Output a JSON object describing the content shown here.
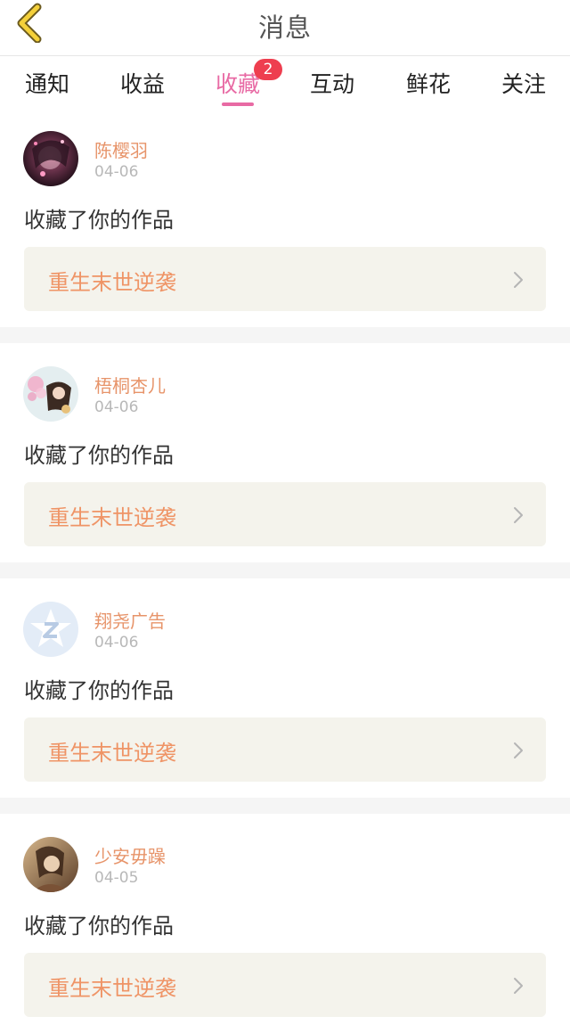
{
  "header": {
    "title": "消息",
    "back_icon": "chevron-left-icon"
  },
  "tabs": [
    {
      "label": "通知",
      "active": false
    },
    {
      "label": "收益",
      "active": false
    },
    {
      "label": "收藏",
      "active": true,
      "badge": "2"
    },
    {
      "label": "互动",
      "active": false
    },
    {
      "label": "鲜花",
      "active": false
    },
    {
      "label": "关注",
      "active": false
    }
  ],
  "colors": {
    "accent": "#e86aa4",
    "badge": "#ee3e4f",
    "username": "#e7946a",
    "work_title": "#ef9466",
    "work_bg": "#f4f3ec"
  },
  "notifications": [
    {
      "user": "陈樱羽",
      "date": "04-06",
      "action": "收藏了你的作品",
      "work": "重生末世逆袭",
      "avatar": "anime-girl-dark-avatar"
    },
    {
      "user": "梧桐杏儿",
      "date": "04-06",
      "action": "收藏了你的作品",
      "work": "重生末世逆袭",
      "avatar": "anime-girl-flowers-avatar"
    },
    {
      "user": "翔尧广告",
      "date": "04-06",
      "action": "收藏了你的作品",
      "work": "重生末世逆袭",
      "avatar": "default-star-z-avatar"
    },
    {
      "user": "少安毋躁",
      "date": "04-05",
      "action": "收藏了你的作品",
      "work": "重生末世逆袭",
      "avatar": "sepia-girl-avatar"
    }
  ]
}
